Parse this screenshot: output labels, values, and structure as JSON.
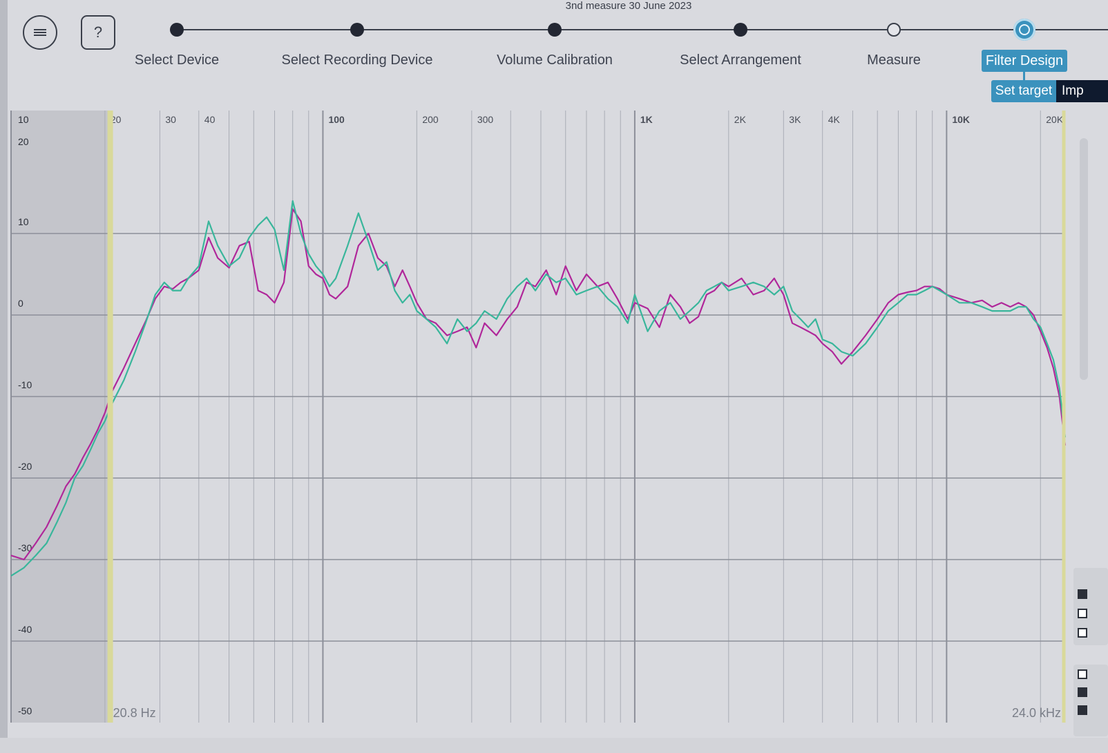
{
  "wizard": {
    "title": "3nd measure 30 June 2023",
    "steps": [
      {
        "label": "Select Device",
        "state": "done"
      },
      {
        "label": "Select Recording Device",
        "state": "done"
      },
      {
        "label": "Volume Calibration",
        "state": "done"
      },
      {
        "label": "Select Arrangement",
        "state": "done"
      },
      {
        "label": "Measure",
        "state": "open"
      },
      {
        "label": "Filter Design",
        "state": "active"
      }
    ],
    "sub_tabs": [
      {
        "label": "Set target"
      },
      {
        "label": "Imp"
      }
    ]
  },
  "toolbar": {
    "help_label": "?",
    "menu_icon": "hamburger-icon",
    "help_icon": "question-icon"
  },
  "colors": {
    "series_1": "#b0279a",
    "series_2": "#39b69b",
    "accent": "#3b92bd",
    "excluded_band": "#c4c5cb",
    "limit_line": "#d9d99a"
  },
  "chart_data": {
    "type": "line",
    "x_scale": "log",
    "xlim": [
      10,
      24000
    ],
    "ylim": [
      -50,
      20
    ],
    "x_tick_labels": [
      {
        "value": 20,
        "label": "20"
      },
      {
        "value": 30,
        "label": "30"
      },
      {
        "value": 40,
        "label": "40"
      },
      {
        "value": 100,
        "label": "100"
      },
      {
        "value": 200,
        "label": "200"
      },
      {
        "value": 300,
        "label": "300"
      },
      {
        "value": 1000,
        "label": "1K"
      },
      {
        "value": 2000,
        "label": "2K"
      },
      {
        "value": 3000,
        "label": "3K"
      },
      {
        "value": 4000,
        "label": "4K"
      },
      {
        "value": 10000,
        "label": "10K"
      },
      {
        "value": 20000,
        "label": "20K"
      }
    ],
    "x_corner_label": "10",
    "y_ticks": [
      {
        "value": 20,
        "label": "20"
      },
      {
        "value": 10,
        "label": "10"
      },
      {
        "value": 0,
        "label": "0"
      },
      {
        "value": -10,
        "label": "-10"
      },
      {
        "value": -20,
        "label": "-20"
      },
      {
        "value": -30,
        "label": "-30"
      },
      {
        "value": -40,
        "label": "-40"
      },
      {
        "value": -50,
        "label": "-50"
      }
    ],
    "grid": true,
    "excluded_below_hz": 20.8,
    "low_limit_label": "20.8 Hz",
    "high_limit_label": "24.0 kHz",
    "high_limit_hz": 24000,
    "series": [
      {
        "color": "#b0279a",
        "x": [
          10,
          11,
          12,
          13,
          14,
          15,
          16,
          17,
          18,
          19,
          20,
          21,
          23,
          25,
          27,
          29,
          31,
          33,
          35,
          37,
          40,
          43,
          46,
          50,
          54,
          58,
          62,
          66,
          70,
          75,
          80,
          85,
          90,
          95,
          100,
          105,
          110,
          120,
          130,
          140,
          150,
          160,
          170,
          180,
          190,
          200,
          215,
          230,
          250,
          270,
          290,
          310,
          330,
          360,
          390,
          420,
          450,
          480,
          520,
          560,
          600,
          650,
          700,
          760,
          820,
          880,
          950,
          1000,
          1100,
          1200,
          1300,
          1400,
          1500,
          1600,
          1700,
          1800,
          1900,
          2000,
          2200,
          2400,
          2600,
          2800,
          3000,
          3200,
          3400,
          3600,
          3800,
          4000,
          4300,
          4600,
          5000,
          5500,
          6000,
          6500,
          7000,
          7500,
          8000,
          8500,
          9000,
          9500,
          10000,
          11000,
          12000,
          13000,
          14000,
          15000,
          16000,
          17000,
          18000,
          19000,
          20000,
          21000,
          22000,
          23000,
          24000
        ],
        "values": [
          -29.5,
          -30.0,
          -28.0,
          -26.0,
          -23.5,
          -21.0,
          -19.5,
          -17.5,
          -15.8,
          -14.0,
          -12.0,
          -9.5,
          -6.5,
          -3.5,
          -0.8,
          2.0,
          3.5,
          3.2,
          4.0,
          4.5,
          5.5,
          9.5,
          7.0,
          5.8,
          8.5,
          9.0,
          3.0,
          2.5,
          1.5,
          4.0,
          13.0,
          11.5,
          6.0,
          5.0,
          4.5,
          2.5,
          2.0,
          3.5,
          8.5,
          10.0,
          7.0,
          6.0,
          3.5,
          5.5,
          3.5,
          1.5,
          -0.5,
          -1.0,
          -2.5,
          -2.0,
          -1.5,
          -4.0,
          -1.0,
          -2.5,
          -0.5,
          1.0,
          4.0,
          3.5,
          5.5,
          2.5,
          6.0,
          3.0,
          5.0,
          3.5,
          4.0,
          2.0,
          -0.5,
          1.5,
          0.8,
          -1.5,
          2.5,
          1.0,
          -1.0,
          -0.2,
          2.5,
          3.0,
          4.0,
          3.5,
          4.5,
          2.5,
          3.0,
          4.5,
          2.5,
          -1.0,
          -1.5,
          -2.0,
          -2.5,
          -3.5,
          -4.5,
          -6.0,
          -4.5,
          -2.5,
          -0.5,
          1.5,
          2.5,
          2.8,
          3.0,
          3.5,
          3.5,
          3.2,
          2.5,
          2.0,
          1.5,
          1.8,
          1.0,
          1.5,
          1.0,
          1.5,
          1.0,
          0.0,
          -2.0,
          -4.0,
          -6.5,
          -10.0,
          -16.0
        ]
      },
      {
        "color": "#39b69b",
        "x": [
          10,
          11,
          12,
          13,
          14,
          15,
          16,
          17,
          18,
          19,
          20,
          21,
          23,
          25,
          27,
          29,
          31,
          33,
          35,
          37,
          40,
          43,
          46,
          50,
          54,
          58,
          62,
          66,
          70,
          75,
          80,
          85,
          90,
          95,
          100,
          105,
          110,
          120,
          130,
          140,
          150,
          160,
          170,
          180,
          190,
          200,
          215,
          230,
          250,
          270,
          290,
          310,
          330,
          360,
          390,
          420,
          450,
          480,
          520,
          560,
          600,
          650,
          700,
          760,
          820,
          880,
          950,
          1000,
          1100,
          1200,
          1300,
          1400,
          1500,
          1600,
          1700,
          1800,
          1900,
          2000,
          2200,
          2400,
          2600,
          2800,
          3000,
          3200,
          3400,
          3600,
          3800,
          4000,
          4300,
          4600,
          5000,
          5500,
          6000,
          6500,
          7000,
          7500,
          8000,
          8500,
          9000,
          9500,
          10000,
          11000,
          12000,
          13000,
          14000,
          15000,
          16000,
          17000,
          18000,
          19000,
          20000,
          21000,
          22000,
          23000,
          24000
        ],
        "values": [
          -32.0,
          -31.0,
          -29.5,
          -28.0,
          -25.5,
          -23.0,
          -20.0,
          -18.5,
          -16.5,
          -14.5,
          -13.0,
          -11.0,
          -8.0,
          -4.5,
          -1.0,
          2.5,
          4.0,
          3.0,
          3.0,
          4.5,
          6.0,
          11.5,
          8.5,
          6.0,
          7.0,
          9.5,
          11.0,
          12.0,
          10.5,
          5.5,
          14.0,
          10.0,
          7.5,
          6.0,
          5.0,
          3.5,
          4.5,
          8.5,
          12.5,
          9.0,
          5.5,
          6.5,
          3.0,
          1.5,
          2.5,
          0.5,
          -0.5,
          -1.5,
          -3.5,
          -0.5,
          -2.0,
          -1.0,
          0.5,
          -0.5,
          2.0,
          3.5,
          4.5,
          3.0,
          5.0,
          4.0,
          4.5,
          2.5,
          3.0,
          3.5,
          2.0,
          1.0,
          -1.0,
          2.5,
          -2.0,
          0.5,
          1.5,
          -0.5,
          0.5,
          1.5,
          3.0,
          3.5,
          4.0,
          3.0,
          3.5,
          4.0,
          3.5,
          2.5,
          3.5,
          0.5,
          -0.5,
          -1.5,
          -0.5,
          -3.0,
          -3.5,
          -4.5,
          -5.0,
          -3.5,
          -1.5,
          0.5,
          1.5,
          2.5,
          2.5,
          3.0,
          3.5,
          3.0,
          2.5,
          1.5,
          1.5,
          1.0,
          0.5,
          0.5,
          0.5,
          1.0,
          1.0,
          -0.5,
          -1.5,
          -3.5,
          -5.5,
          -9.0,
          -15.0
        ]
      }
    ]
  }
}
